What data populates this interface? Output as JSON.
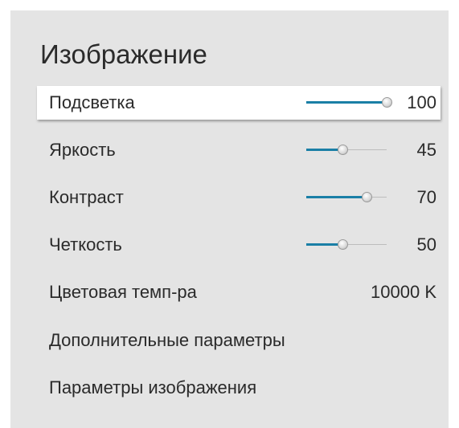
{
  "menu": {
    "title": "Изображение",
    "items": [
      {
        "label": "Подсветка",
        "value": "100",
        "level": 1.0,
        "selected": true
      },
      {
        "label": "Яркость",
        "value": "45",
        "level": 0.45
      },
      {
        "label": "Контраст",
        "value": "70",
        "level": 0.75
      },
      {
        "label": "Четкость",
        "value": "50",
        "level": 0.45
      },
      {
        "label": "Цветовая темп-ра",
        "value": "10000 K"
      },
      {
        "label": "Дополнительные параметры"
      },
      {
        "label": "Параметры изображения"
      }
    ]
  },
  "colors": {
    "slider_fill": "#1a7fa6",
    "panel_bg": "#e4e4e4",
    "selected_bg": "#ffffff"
  }
}
